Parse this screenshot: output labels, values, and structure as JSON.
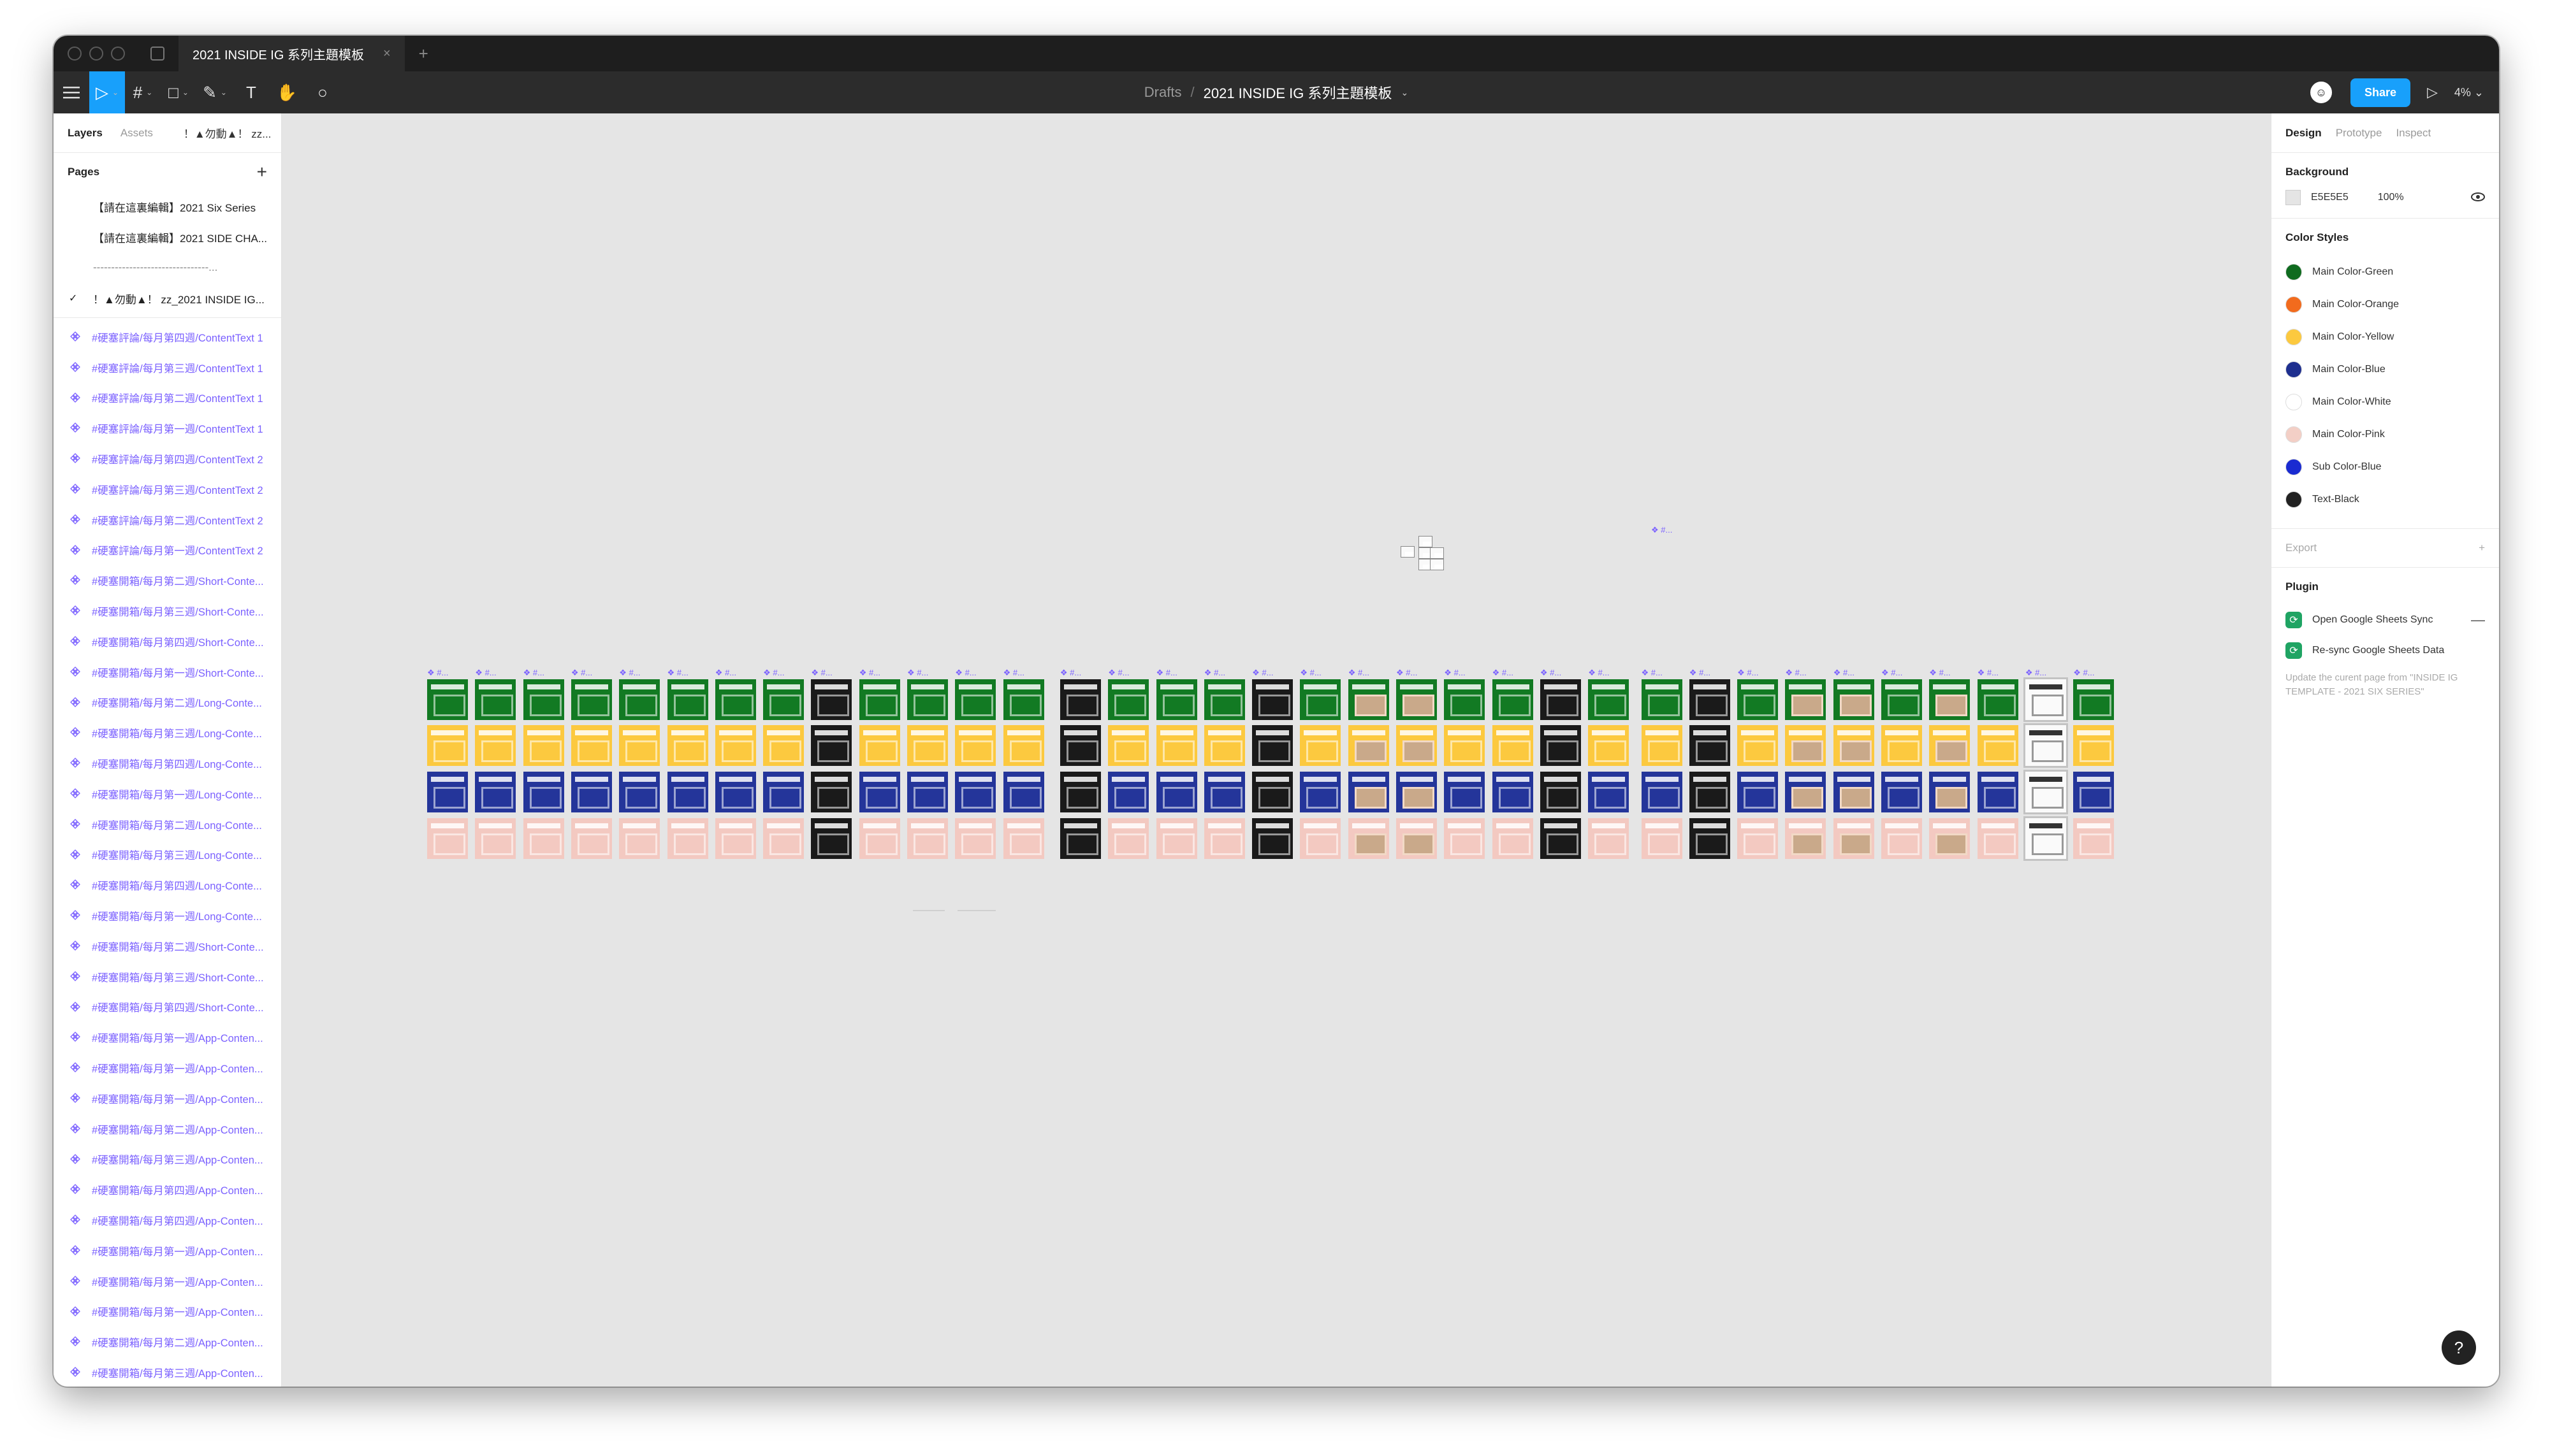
{
  "window": {
    "file_tab": "2021 INSIDE IG 系列主題模板",
    "file_tab_close": "×",
    "new_tab": "+"
  },
  "toolbar": {
    "menu_icon": "hamburger-menu-icon",
    "tools": [
      {
        "name": "move-tool",
        "glyph": "▷",
        "active": true
      },
      {
        "name": "frame-tool",
        "glyph": "#"
      },
      {
        "name": "shape-tool",
        "glyph": "□"
      },
      {
        "name": "pen-tool",
        "glyph": "✎"
      },
      {
        "name": "text-tool",
        "glyph": "T"
      },
      {
        "name": "hand-tool",
        "glyph": "✋"
      },
      {
        "name": "comment-tool",
        "glyph": "○"
      }
    ],
    "breadcrumb_drafts": "Drafts",
    "breadcrumb_sep": "/",
    "breadcrumb_file": "2021 INSIDE IG 系列主題模板",
    "share_label": "Share",
    "play_glyph": "▷",
    "zoom": "4%"
  },
  "left_panel": {
    "tab_layers": "Layers",
    "tab_assets": "Assets",
    "page_selector": "！▲勿動▲！ zz...",
    "pages_title": "Pages",
    "add_page": "+",
    "pages": [
      {
        "label": "【請在這裏編輯】2021 Six Series",
        "current": false
      },
      {
        "label": "【請在這裏編輯】2021 SIDE CHA...",
        "current": false
      },
      {
        "label": "--------------------------------...",
        "current": false,
        "divider": true
      },
      {
        "label": "！▲勿動▲！ zz_2021 INSIDE IG...",
        "current": true
      }
    ],
    "current_check": "✓",
    "layers": [
      "#硬塞評論/每月第四週/ContentText 1",
      "#硬塞評論/每月第三週/ContentText 1",
      "#硬塞評論/每月第二週/ContentText 1",
      "#硬塞評論/每月第一週/ContentText 1",
      "#硬塞評論/每月第四週/ContentText 2",
      "#硬塞評論/每月第三週/ContentText 2",
      "#硬塞評論/每月第二週/ContentText 2",
      "#硬塞評論/每月第一週/ContentText 2",
      "#硬塞開箱/每月第二週/Short-Conte...",
      "#硬塞開箱/每月第三週/Short-Conte...",
      "#硬塞開箱/每月第四週/Short-Conte...",
      "#硬塞開箱/每月第一週/Short-Conte...",
      "#硬塞開箱/每月第二週/Long-Conte...",
      "#硬塞開箱/每月第三週/Long-Conte...",
      "#硬塞開箱/每月第四週/Long-Conte...",
      "#硬塞開箱/每月第一週/Long-Conte...",
      "#硬塞開箱/每月第二週/Long-Conte...",
      "#硬塞開箱/每月第三週/Long-Conte...",
      "#硬塞開箱/每月第四週/Long-Conte...",
      "#硬塞開箱/每月第一週/Long-Conte...",
      "#硬塞開箱/每月第二週/Short-Conte...",
      "#硬塞開箱/每月第三週/Short-Conte...",
      "#硬塞開箱/每月第四週/Short-Conte...",
      "#硬塞開箱/每月第一週/App-Conten...",
      "#硬塞開箱/每月第一週/App-Conten...",
      "#硬塞開箱/每月第一週/App-Conten...",
      "#硬塞開箱/每月第二週/App-Conten...",
      "#硬塞開箱/每月第三週/App-Conten...",
      "#硬塞開箱/每月第四週/App-Conten...",
      "#硬塞開箱/每月第四週/App-Conten...",
      "#硬塞開箱/每月第一週/App-Conten...",
      "#硬塞開箱/每月第一週/App-Conten...",
      "#硬塞開箱/每月第一週/App-Conten...",
      "#硬塞開箱/每月第二週/App-Conten...",
      "#硬塞開箱/每月第三週/App-Conten..."
    ]
  },
  "right_panel": {
    "tab_design": "Design",
    "tab_prototype": "Prototype",
    "tab_inspect": "Inspect",
    "background_title": "Background",
    "background_hex": "E5E5E5",
    "background_opacity": "100%",
    "visibility_icon": "eye-icon",
    "color_styles_title": "Color Styles",
    "color_styles": [
      {
        "name": "Main Color-Green",
        "color": "#0f6b1f"
      },
      {
        "name": "Main Color-Orange",
        "color": "#f26b1d"
      },
      {
        "name": "Main Color-Yellow",
        "color": "#fcc93f"
      },
      {
        "name": "Main Color-Blue",
        "color": "#1e2f8f"
      },
      {
        "name": "Main Color-White",
        "color": "#ffffff"
      },
      {
        "name": "Main Color-Pink",
        "color": "#f3cfc6"
      },
      {
        "name": "Sub Color-Blue",
        "color": "#1a2bd1"
      },
      {
        "name": "Text-Black",
        "color": "#222222"
      }
    ],
    "export_title": "Export",
    "export_add": "+",
    "plugin_title": "Plugin",
    "plugins": [
      {
        "label": "Open Google Sheets Sync",
        "has_minus": true
      },
      {
        "label": "Re-sync Google Sheets Data",
        "has_minus": false
      }
    ],
    "plugin_glyph": "⟳",
    "plugin_minus": "—",
    "plugin_description": "Update the curent page from \"INSIDE IG TEMPLATE - 2021 SIX SERIES\"",
    "help": "?"
  },
  "canvas": {
    "frame_label": "❖ #...",
    "row_colors": [
      "#127a23",
      "#fcc93f",
      "#24359a",
      "#f3c9c1"
    ],
    "column_count": 35,
    "special_columns": {
      "checker": [
        11,
        12,
        15,
        16,
        21,
        22
      ],
      "dark": [
        8,
        13,
        17,
        23,
        26
      ],
      "photo": [
        19,
        20,
        28,
        29,
        31
      ],
      "doc": [
        33
      ]
    }
  }
}
